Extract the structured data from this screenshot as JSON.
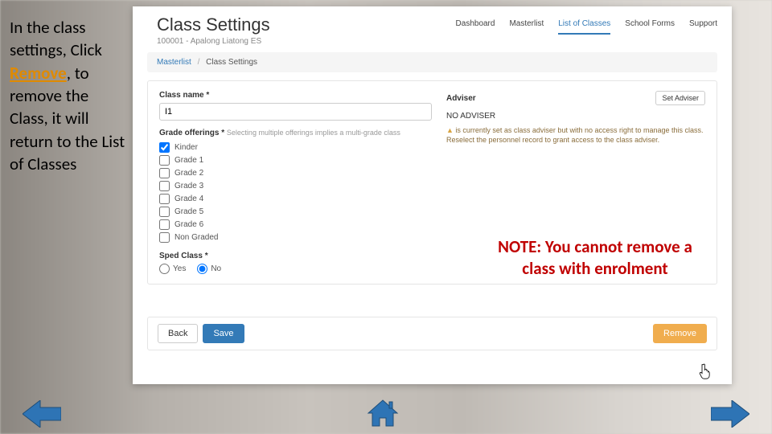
{
  "instruction": {
    "pre": "In the class settings, Click ",
    "remove": "Remove",
    "post": ", to remove the Class, it will return to the List of Classes"
  },
  "app": {
    "title": "Class Settings",
    "subtitle": "100001 - Apalong Liatong ES",
    "nav": {
      "dashboard": "Dashboard",
      "masterlist": "Masterlist",
      "list_of_classes": "List of Classes",
      "school_forms": "School Forms",
      "support": "Support"
    },
    "breadcrumb": {
      "root": "Masterlist",
      "current": "Class Settings"
    },
    "left": {
      "class_name_label": "Class name *",
      "class_name_value": "I1",
      "grade_label": "Grade offerings *",
      "grade_hint": "Selecting multiple offerings implies a multi-grade class",
      "grades": {
        "kinder": "Kinder",
        "g1": "Grade 1",
        "g2": "Grade 2",
        "g3": "Grade 3",
        "g4": "Grade 4",
        "g5": "Grade 5",
        "g6": "Grade 6",
        "ng": "Non Graded"
      },
      "sped_label": "Sped Class *",
      "yes": "Yes",
      "no": "No"
    },
    "right": {
      "adviser_label": "Adviser",
      "set_adviser": "Set Adviser",
      "no_adviser": "NO ADVISER",
      "warning": " is currently set as class adviser but with no access right to manage this class. Reselect the personnel record to grant access to the class adviser."
    },
    "footer": {
      "back": "Back",
      "save": "Save",
      "remove": "Remove"
    }
  },
  "note": {
    "text": "NOTE: You cannot remove a class with enrolment"
  }
}
